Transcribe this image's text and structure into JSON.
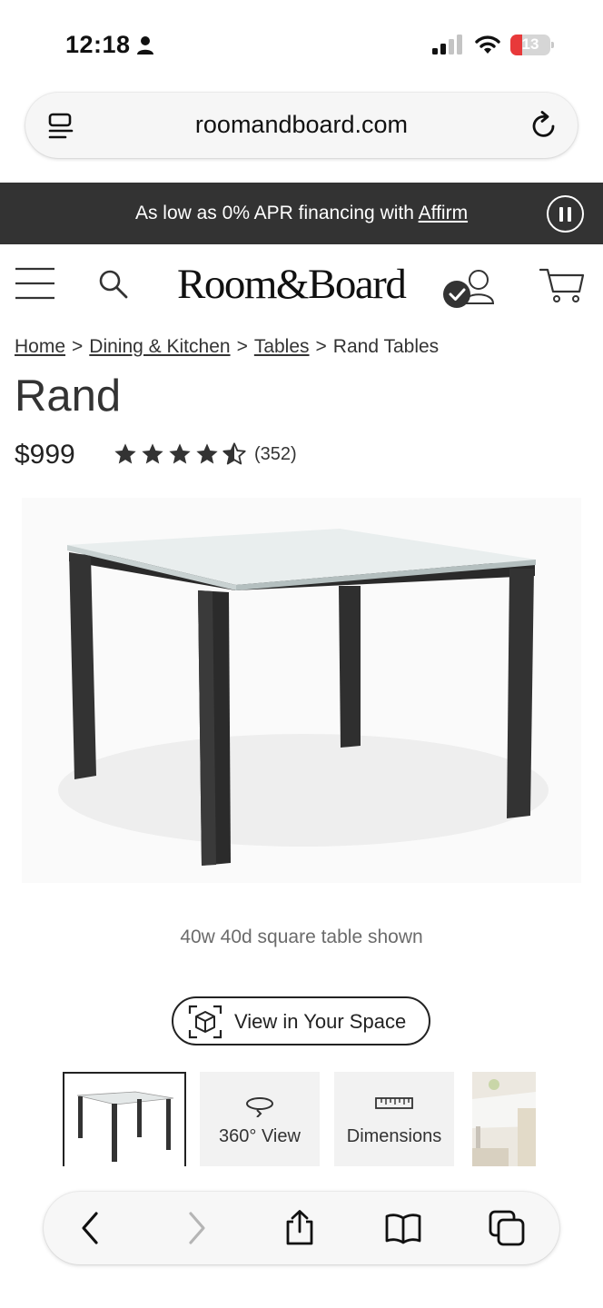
{
  "status_bar": {
    "time": "12:18",
    "battery": "13"
  },
  "browser": {
    "url": "roomandboard.com"
  },
  "promo": {
    "text": "As low as 0% APR financing with ",
    "link": "Affirm"
  },
  "header": {
    "logo": "Room&Board"
  },
  "breadcrumb": [
    {
      "label": "Home",
      "link": true
    },
    {
      "label": "Dining & Kitchen",
      "link": true
    },
    {
      "label": "Tables",
      "link": true
    },
    {
      "label": "Rand Tables",
      "link": false
    }
  ],
  "breadcrumb_separator": ">",
  "product": {
    "title": "Rand",
    "price": "$999",
    "rating": 4.5,
    "rating_max": 5,
    "review_count": "(352)",
    "image_caption": "40w 40d square table shown",
    "view_in_space_label": "View in Your Space"
  },
  "thumbnails": [
    {
      "type": "image",
      "selected": true
    },
    {
      "type": "360",
      "label": "360° View",
      "icon": "rotate-360-icon"
    },
    {
      "type": "dimensions",
      "label": "Dimensions",
      "icon": "ruler-icon"
    },
    {
      "type": "image",
      "selected": false
    }
  ],
  "colors": {
    "promo_bg": "#333333",
    "text": "#222222",
    "caption": "#6b6b6b",
    "battery_low": "#e8393a"
  }
}
